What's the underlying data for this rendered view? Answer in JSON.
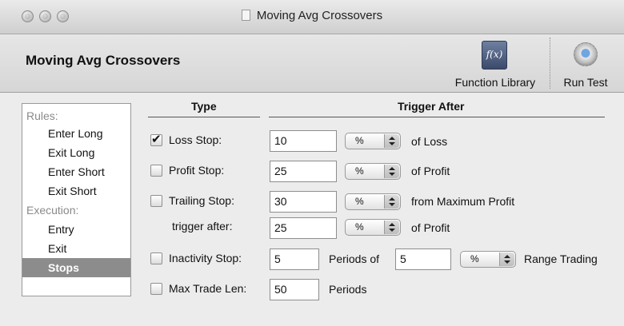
{
  "window": {
    "title": "Moving Avg Crossovers",
    "document_icon": "document-icon"
  },
  "toolbar": {
    "title": "Moving Avg Crossovers",
    "function_library_label": "Function Library",
    "function_library_icon": "function-library-icon",
    "function_library_glyph": "f(x)",
    "run_test_label": "Run Test",
    "run_test_icon": "gear-icon"
  },
  "sidebar": {
    "rules_header": "Rules:",
    "execution_header": "Execution:",
    "rules_items": [
      "Enter Long",
      "Exit Long",
      "Enter Short",
      "Exit Short"
    ],
    "execution_items": [
      "Entry",
      "Exit",
      "Stops"
    ],
    "selected": "Stops"
  },
  "columns": {
    "type": "Type",
    "trigger_after": "Trigger After"
  },
  "stops": {
    "loss": {
      "label": "Loss Stop:",
      "checked": true,
      "value": "10",
      "unit": "%",
      "suffix": "of Loss"
    },
    "profit": {
      "label": "Profit Stop:",
      "checked": false,
      "value": "25",
      "unit": "%",
      "suffix": "of Profit"
    },
    "trailing": {
      "label": "Trailing Stop:",
      "checked": false,
      "value": "30",
      "unit": "%",
      "suffix": "from Maximum Profit"
    },
    "trailing_trigger": {
      "label": "trigger after:",
      "value": "25",
      "unit": "%",
      "suffix": "of Profit"
    },
    "inactivity": {
      "label": "Inactivity Stop:",
      "checked": false,
      "periods_value": "5",
      "periods_label": "Periods of",
      "range_value": "5",
      "unit": "%",
      "suffix": "Range Trading"
    },
    "max_trade_len": {
      "label": "Max Trade Len:",
      "checked": false,
      "value": "50",
      "suffix": "Periods"
    }
  },
  "colors": {
    "selected_row": "#8c8c8c",
    "window_bg": "#ececec"
  }
}
